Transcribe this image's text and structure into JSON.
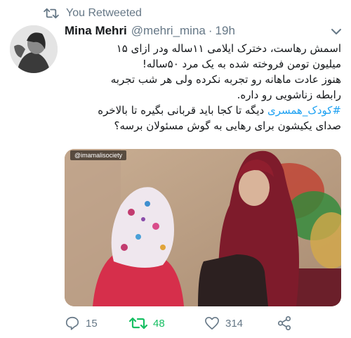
{
  "retweet_header": {
    "label": "You Retweeted",
    "icon": "retweet-icon"
  },
  "author": {
    "name": "Mina Mehri",
    "handle": "@mehri_mina",
    "separator": "·",
    "time": "19h"
  },
  "tweet": {
    "line1": "اسمش رهاست، دخترک ایلامی ۱۱ساله ودر ازای ۱۵",
    "line2": "میلیون تومن فروخته شده به یک مرد ۵۰ساله!",
    "line3": "هنوز عادت ماهانه رو تجربه نکرده ولی هر شب تجربه",
    "line4": "رابطه زناشویی رو داره.",
    "hashtag": "#کودک_همسری",
    "line5_rest": " دیگه تا کجا باید قربانی بگیره تا بالاخره",
    "line6": "صدای یکیشون برای رهایی به گوش مسئولان برسه؟"
  },
  "media": {
    "watermark": "@imamalisociety"
  },
  "actions": {
    "replies": "15",
    "retweets": "48",
    "likes": "314"
  },
  "colors": {
    "accent": "#1da1f2",
    "retweet": "#17bf63",
    "muted": "#657786"
  }
}
